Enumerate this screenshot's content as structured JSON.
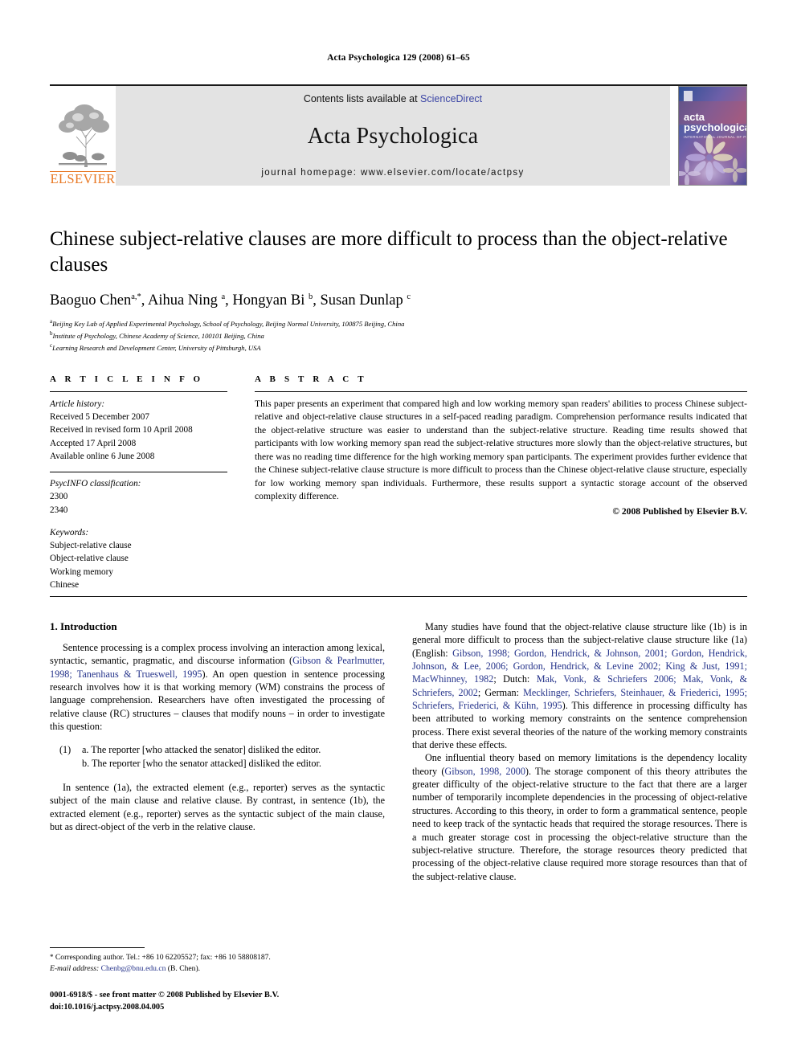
{
  "running_head": "Acta Psychologica 129 (2008) 61–65",
  "masthead": {
    "publisher_name": "ELSEVIER",
    "contents_prefix": "Contents lists available at ",
    "sciencedirect_label": "ScienceDirect",
    "journal_title": "Acta Psychologica",
    "homepage_line": "journal homepage: www.elsevier.com/locate/actpsy",
    "cover_title_line1": "acta",
    "cover_title_line2": "psychologica",
    "cover_subtitle": "INTERNATIONAL JOURNAL OF PSYCHONOMICS",
    "link_color": "#3b45a5",
    "elsevier_orange": "#E87722",
    "banner_bg": "#e3e3e3"
  },
  "title_block": {
    "title": "Chinese subject-relative clauses are more difficult to process than the object-relative clauses",
    "authors_html": "Baoguo Chen<sup>a,*</sup>, Aihua Ning <sup>a</sup>, Hongyan Bi <sup>b</sup>, Susan Dunlap <sup>c</sup>",
    "affiliations": [
      {
        "marker": "a",
        "text": "Beijing Key Lab of Applied Experimental Psychology, School of Psychology, Beijing Normal University, 100875 Beijing, China"
      },
      {
        "marker": "b",
        "text": "Institute of Psychology, Chinese Academy of Science, 100101 Beijing, China"
      },
      {
        "marker": "c",
        "text": "Learning Research and Development Center, University of Pittsburgh, USA"
      }
    ]
  },
  "article_info": {
    "heading": "A R T I C L E   I N F O",
    "history_label": "Article history:",
    "history": [
      "Received 5 December 2007",
      "Received in revised form 10 April 2008",
      "Accepted 17 April 2008",
      "Available online 6 June 2008"
    ],
    "classification_label": "PsycINFO classification:",
    "classification": [
      "2300",
      "2340"
    ],
    "keywords_label": "Keywords:",
    "keywords": [
      "Subject-relative clause",
      "Object-relative clause",
      "Working memory",
      "Chinese"
    ]
  },
  "abstract": {
    "heading": "A B S T R A C T",
    "text": "This paper presents an experiment that compared high and low working memory span readers' abilities to process Chinese subject-relative and object-relative clause structures in a self-paced reading paradigm. Comprehension performance results indicated that the object-relative structure was easier to understand than the subject-relative structure. Reading time results showed that participants with low working memory span read the subject-relative structures more slowly than the object-relative structures, but there was no reading time difference for the high working memory span participants. The experiment provides further evidence that the Chinese subject-relative clause structure is more difficult to process than the Chinese object-relative clause structure, especially for low working memory span individuals. Furthermore, these results support a syntactic storage account of the observed complexity difference.",
    "copyright": "© 2008 Published by Elsevier B.V."
  },
  "body": {
    "section_title": "1. Introduction",
    "left_para_1_pre": "Sentence processing is a complex process involving an interaction among lexical, syntactic, semantic, pragmatic, and discourse information (",
    "left_para_1_ref": "Gibson & Pearlmutter, 1998; Tanenhaus & Trueswell, 1995",
    "left_para_1_post": "). An open question in sentence processing research involves how it is that working memory (WM) constrains the process of language comprehension. Researchers have often investigated the processing of relative clause (RC) structures – clauses that modify nouns – in order to investigate this question:",
    "example_number": "(1)",
    "example_a": "a. The reporter [who attacked the senator] disliked the editor.",
    "example_b": "b. The reporter [who the senator attacked] disliked the editor.",
    "left_para_2": "In sentence (1a), the extracted element (e.g., reporter) serves as the syntactic subject of the main clause and relative clause. By contrast, in sentence (1b), the extracted element (e.g., reporter) serves as the syntactic subject of the main clause, but as direct-object of the verb in the relative clause.",
    "right_para_1_pre": "Many studies have found that the object-relative clause structure like (1b) is in general more difficult to process than the subject-relative clause structure like (1a) (English: ",
    "right_para_1_ref": "Gibson, 1998; Gordon, Hendrick, & Johnson, 2001; Gordon, Hendrick, Johnson, & Lee, 2006; Gordon, Hendrick, & Levine 2002; King & Just, 1991; MacWhinney, 1982",
    "right_para_1_mid1": "; Dutch: ",
    "right_para_1_ref2": "Mak, Vonk, & Schriefers 2006; Mak, Vonk, & Schriefers, 2002",
    "right_para_1_mid2": "; German: ",
    "right_para_1_ref3": "Mecklinger, Schriefers, Steinhauer, & Friederici, 1995; Schriefers, Friederici, & Kühn, 1995",
    "right_para_1_post": "). This difference in processing difficulty has been attributed to working memory constraints on the sentence comprehension process. There exist several theories of the nature of the working memory constraints that derive these effects.",
    "right_para_2_pre": "One influential theory based on memory limitations is the dependency locality theory (",
    "right_para_2_ref": "Gibson, 1998, 2000",
    "right_para_2_post": "). The storage component of this theory attributes the greater difficulty of the object-relative structure to the fact that there are a larger number of temporarily incomplete dependencies in the processing of object-relative structures. According to this theory, in order to form a grammatical sentence, people need to keep track of the syntactic heads that required the storage resources. There is a much greater storage cost in processing the object-relative structure than the subject-relative structure. Therefore, the storage resources theory predicted that processing of the object-relative clause required more storage resources than that of the subject-relative clause."
  },
  "footnote": {
    "star": "*",
    "corresponding": "Corresponding author. Tel.: +86 10 62205527; fax: +86 10 58808187.",
    "email_label": "E-mail address:",
    "email": "Chenbg@bnu.edu.cn",
    "email_owner": "(B. Chen)."
  },
  "imprint": {
    "line1": "0001-6918/$ - see front matter © 2008 Published by Elsevier B.V.",
    "line2": "doi:10.1016/j.actpsy.2008.04.005"
  }
}
